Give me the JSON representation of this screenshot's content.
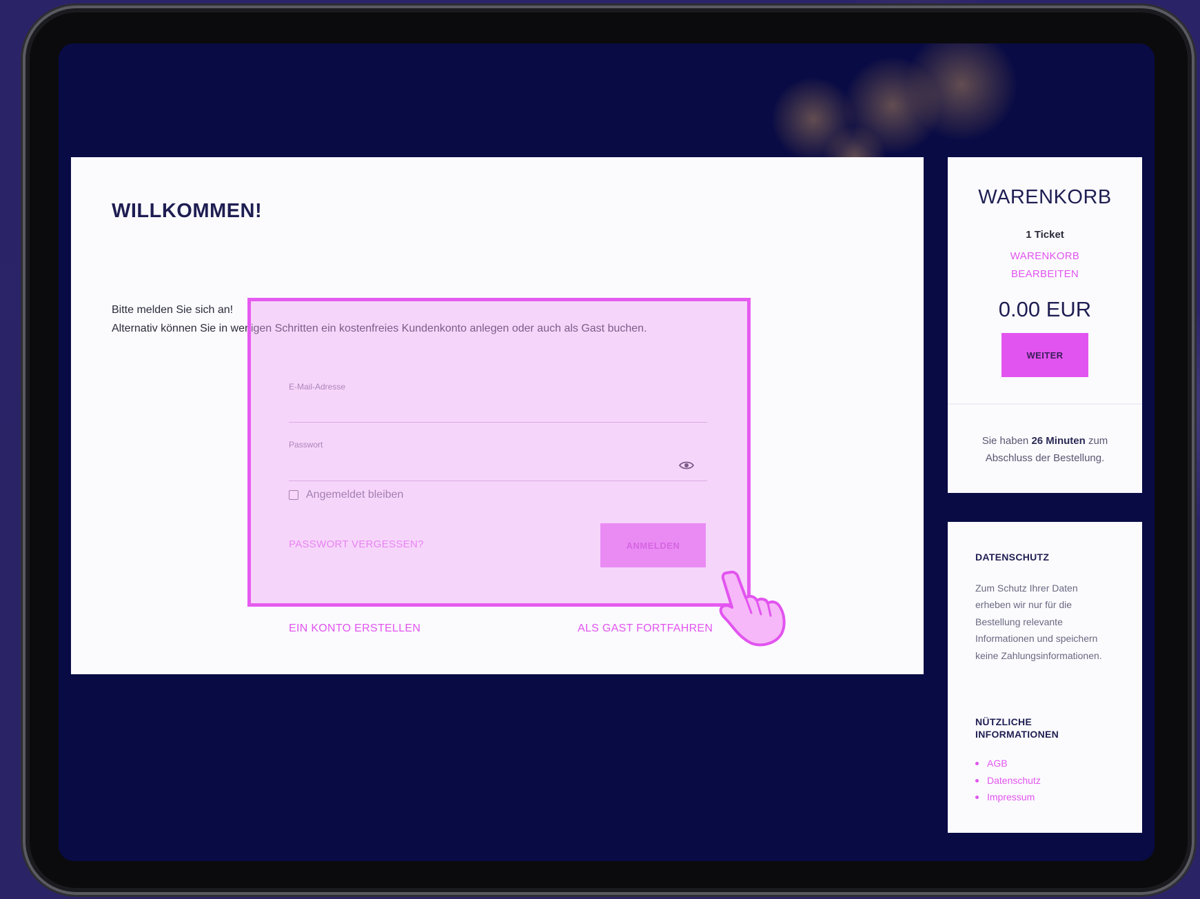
{
  "login": {
    "title": "WILLKOMMEN!",
    "intro_line1": "Bitte melden Sie sich an!",
    "intro_line2": "Alternativ können Sie in wenigen Schritten ein kostenfreies Kundenkonto anlegen oder auch als Gast buchen.",
    "email_label": "E-Mail-Adresse",
    "email_value": "",
    "password_label": "Passwort",
    "password_value": "",
    "remember_label": "Angemeldet bleiben",
    "remember_checked": false,
    "forgot_link": "PASSWORT VERGESSEN?",
    "login_button": "ANMELDEN",
    "create_account_link": "EIN KONTO ERSTELLEN",
    "guest_link": "ALS GAST FORTFAHREN"
  },
  "cart": {
    "title": "WARENKORB",
    "count": "1 Ticket",
    "edit_line1": "WARENKORB",
    "edit_line2": "BEARBEITEN",
    "total": "0.00 EUR",
    "continue_button": "WEITER",
    "timer_prefix": "Sie haben",
    "timer_value": "26 Minuten",
    "timer_suffix1": "zum",
    "timer_suffix2": "Abschluss der Bestellung."
  },
  "info": {
    "privacy_heading": "DATENSCHUTZ",
    "privacy_text": "Zum Schutz Ihrer Daten erheben wir nur für die Bestellung relevante Informationen und speichern keine Zahlungsinformationen.",
    "useful_heading_line1": "NÜTZLICHE",
    "useful_heading_line2": "INFORMATIONEN",
    "links": [
      "AGB",
      "Datenschutz",
      "Impressum"
    ]
  },
  "colors": {
    "accent": "#e254ef",
    "highlight": "#e55bf0",
    "screen_bg": "#090b45",
    "title": "#1f1e52"
  },
  "icons": {
    "password_toggle": "eye-icon",
    "pointer": "hand-pointer-icon"
  }
}
